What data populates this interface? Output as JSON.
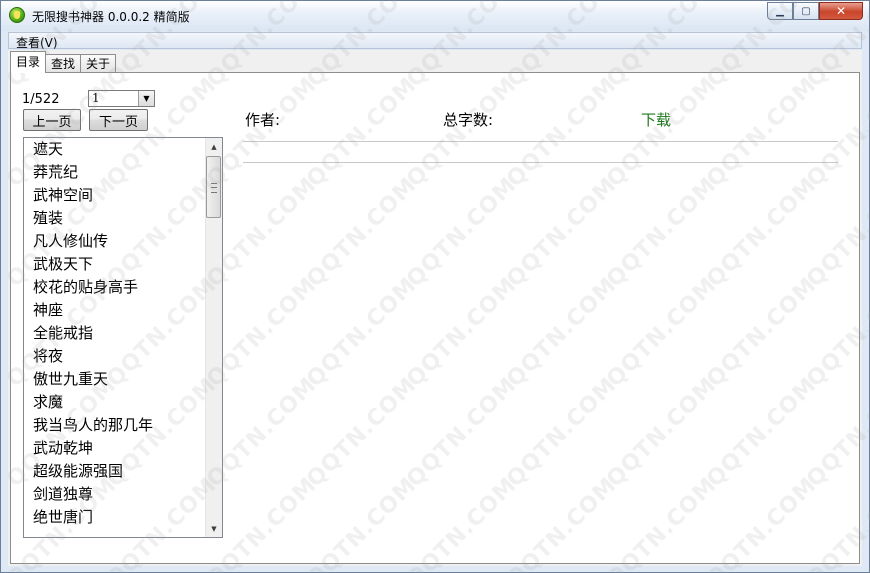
{
  "window": {
    "title": "无限搜书神器 0.0.0.2 精简版"
  },
  "menu": {
    "view_label": "查看(V)"
  },
  "tabs": [
    {
      "label": "目录",
      "active": true
    },
    {
      "label": "查找",
      "active": false
    },
    {
      "label": "关于",
      "active": false
    }
  ],
  "pager": {
    "counter": "1/522",
    "selected_page": "1",
    "prev_label": "上一页",
    "next_label": "下一页"
  },
  "book_list": [
    "遮天",
    "莽荒纪",
    "武神空间",
    "殖装",
    "凡人修仙传",
    "武极天下",
    "校花的贴身高手",
    "神座",
    "全能戒指",
    "将夜",
    "傲世九重天",
    "求魔",
    "我当鸟人的那几年",
    "武动乾坤",
    "超级能源强国",
    "剑道独尊",
    "绝世唐门"
  ],
  "detail": {
    "author_label": "作者:",
    "word_count_label": "总字数:",
    "download_label": "下载"
  },
  "watermark": {
    "text": "QQTN.COM"
  },
  "colors": {
    "download_link": "#1e7a1e",
    "titlebar": "#dbe6f4"
  }
}
